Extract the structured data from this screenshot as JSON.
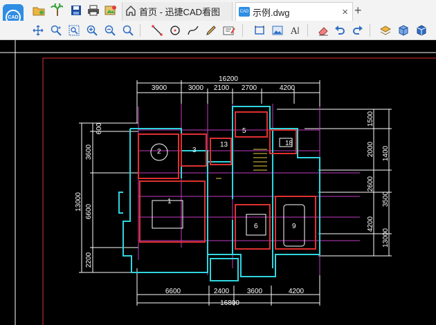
{
  "tabs": {
    "home_label": "首页 - 迅捷CAD看图",
    "file_label": "示例.dwg",
    "close_symbol": "×",
    "new_tab_symbol": "+"
  },
  "logo": {
    "text": "CAD"
  },
  "file_badge": "CAD",
  "toolbar_top_icons": [
    "open-folder-icon",
    "palm-tree-icon",
    "save-icon",
    "print-icon",
    "export-image-icon"
  ],
  "toolbar_icons": [
    "pan-icon",
    "zoom-realtime-icon",
    "zoom-window-icon",
    "zoom-in-icon",
    "zoom-out-icon",
    "line-icon",
    "circle-icon",
    "polyline-icon",
    "pen-icon",
    "text-edit-icon",
    "measure-area-icon",
    "image-icon",
    "text-icon",
    "eraser-icon",
    "undo-icon",
    "redo-icon",
    "layer-icon",
    "cube-icon",
    "cube-3d-icon"
  ],
  "drawing": {
    "top_total": "16200",
    "top_dims": [
      "3900",
      "3000",
      "2100",
      "2700",
      "4200"
    ],
    "bottom_total": "16800",
    "bottom_dims": [
      "6600",
      "2400",
      "3600",
      "4200"
    ],
    "left_total": "13000",
    "left_dims": [
      "600",
      "3600",
      "6600",
      "2200"
    ],
    "right_total": "13000",
    "right_dims_a": [
      "1500",
      "2000",
      "2600",
      "4200"
    ],
    "right_dims_b": [
      "1400",
      "3500"
    ],
    "rooms": [
      "1",
      "2",
      "3",
      "5",
      "6",
      "9",
      "13",
      "18"
    ]
  },
  "colors": {
    "canvas_bg": "#000000",
    "border_red": "#e03030",
    "wall_cyan": "#2fd6e0",
    "wall_magenta": "#e040e0",
    "dim_white": "#ffffff",
    "accent_blue": "#2f8de4"
  }
}
